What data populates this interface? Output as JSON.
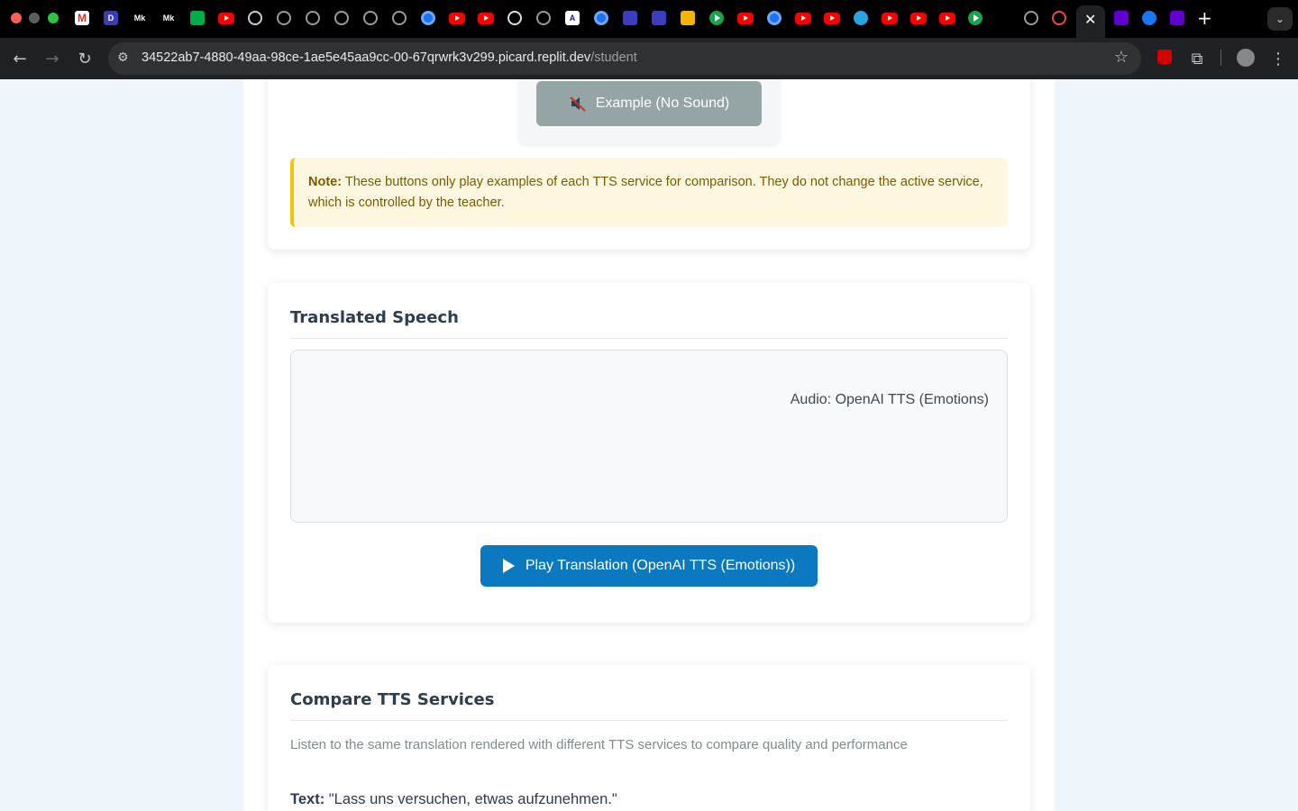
{
  "browser": {
    "url_host": "34522ab7-4880-49aa-98ce-1ae5e45aa9cc-00-67qrwrk3v299.picard.replit.dev",
    "url_path": "/student",
    "tab_favicons": [
      "gmail-icon",
      "d-icon",
      "mk-icon",
      "mk-icon",
      "meet-icon",
      "youtube-icon",
      "smiley-icon",
      "globe-icon",
      "globe-icon",
      "globe-icon",
      "globe-icon",
      "globe-icon",
      "blue-circle-icon",
      "youtube-icon",
      "youtube-icon",
      "openai-icon",
      "globe-icon",
      "a-icon",
      "blue-circle-icon",
      "stack-icon",
      "stack-icon",
      "drive-icon",
      "green-play-icon",
      "youtube-icon",
      "blue-circle-icon",
      "youtube-icon",
      "youtube-icon",
      "telegram-icon",
      "youtube-icon",
      "youtube-icon",
      "youtube-icon",
      "green-play-icon",
      "slack-icon",
      "globe-icon",
      "record-icon",
      "close-icon",
      "yahoo-icon",
      "facebook-icon",
      "yahoo-icon"
    ]
  },
  "example_card": {
    "example_button_label": "Example (No Sound)",
    "note_label": "Note:",
    "note_text": "These buttons only play examples of each TTS service for comparison. They do not change the active service, which is controlled by the teacher."
  },
  "translated_speech": {
    "title": "Translated Speech",
    "audio_label": "Audio: OpenAI TTS (Emotions)",
    "play_button_label": "Play Translation (OpenAI TTS (Emotions))"
  },
  "compare": {
    "title": "Compare TTS Services",
    "description": "Listen to the same translation rendered with different TTS services to compare quality and performance",
    "text_label": "Text:",
    "text_value": "\"Lass uns versuchen, etwas aufzunehmen.\""
  },
  "colors": {
    "accent_blue": "#0b79c0",
    "example_gray": "#95a5a6",
    "note_border": "#f1c40f",
    "note_bg": "#fff8e1"
  }
}
